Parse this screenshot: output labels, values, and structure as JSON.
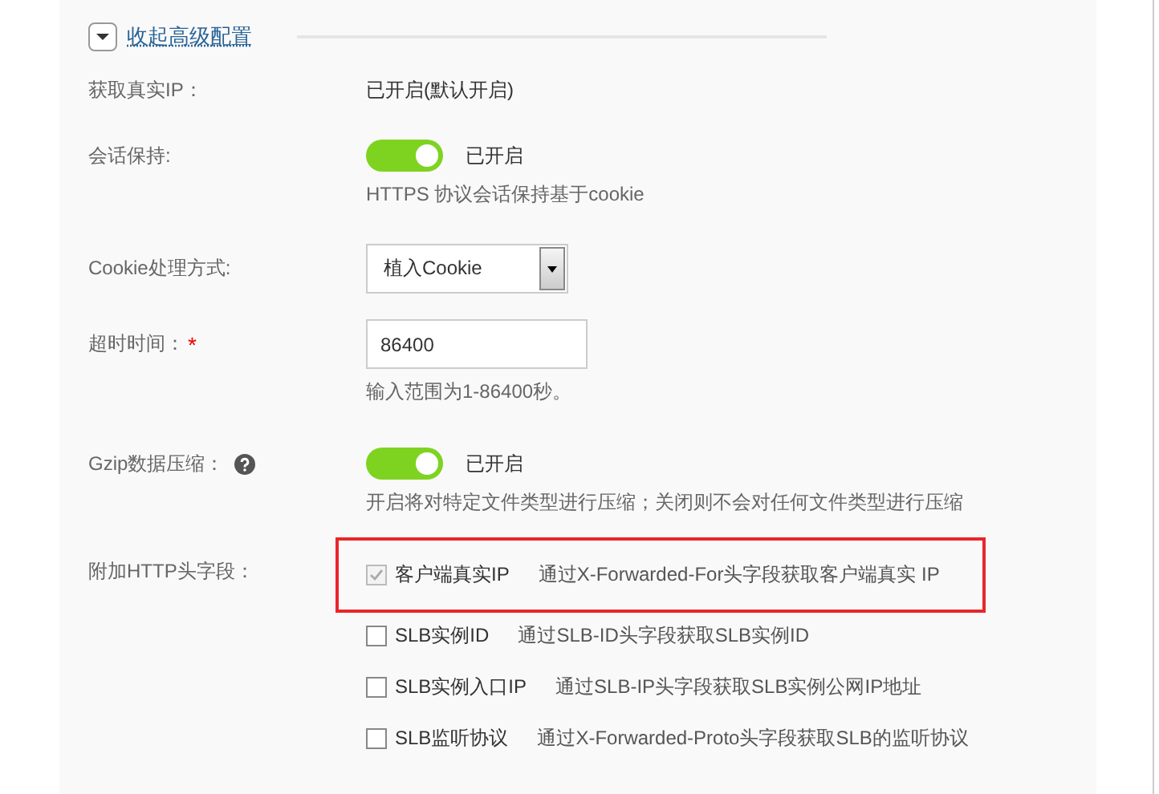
{
  "advanced_toggle": {
    "label": "收起高级配置",
    "expanded": true
  },
  "fields": [
    {
      "kind": "text",
      "label": "获取真实IP：",
      "value": "已开启(默认开启)"
    },
    {
      "kind": "switch",
      "label": "会话保持:",
      "on": true,
      "state_text": "已开启",
      "hint": "HTTPS 协议会话保持基于cookie"
    },
    {
      "kind": "select",
      "label": "Cookie处理方式:",
      "value": "植入Cookie"
    },
    {
      "kind": "input",
      "label": "超时时间：",
      "required_mark": "*",
      "value": "86400",
      "hint": "输入范围为1-86400秒。"
    },
    {
      "kind": "switch",
      "label": "Gzip数据压缩：",
      "help": true,
      "on": true,
      "state_text": "已开启",
      "hint": "开启将对特定文件类型进行压缩；关闭则不会对任何文件类型进行压缩"
    },
    {
      "kind": "checkboxes",
      "label": "附加HTTP头字段：",
      "options": [
        {
          "label": "客户端真实IP",
          "description": "通过X-Forwarded-For头字段获取客户端真实 IP",
          "checked": true,
          "disabled": true,
          "highlighted": true
        },
        {
          "label": "SLB实例ID",
          "description": "通过SLB-ID头字段获取SLB实例ID",
          "checked": false,
          "disabled": false,
          "highlighted": false
        },
        {
          "label": "SLB实例入口IP",
          "description": "通过SLB-IP头字段获取SLB实例公网IP地址",
          "checked": false,
          "disabled": false,
          "highlighted": false
        },
        {
          "label": "SLB监听协议",
          "description": "通过X-Forwarded-Proto头字段获取SLB的监听协议",
          "checked": false,
          "disabled": false,
          "highlighted": false
        }
      ]
    }
  ]
}
